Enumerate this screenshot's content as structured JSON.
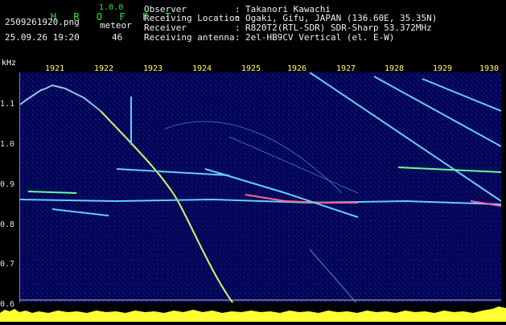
{
  "header": {
    "app_name": "H R O F F T",
    "version": "1.0.0",
    "filename": "2509261920.png",
    "datetime": "25.09.26 19:20",
    "counter_label": "meteor",
    "counter_value": "46",
    "info": [
      {
        "label": "Observer",
        "sep": ":",
        "value": "Takanori Kawachi"
      },
      {
        "label": "Receiving Location",
        "sep": ":",
        "value": "Ogaki, Gifu, JAPAN (136.60E, 35.35N)"
      },
      {
        "label": "Receiver",
        "sep": ":",
        "value": "R820T2(RTL-SDR) SDR-Sharp 53.372MHz"
      },
      {
        "label": "Receiving antenna",
        "sep": ":",
        "value": "2el-HB9CV Vertical (el. E-W)"
      }
    ]
  },
  "spectrogram": {
    "y_unit": "kHz",
    "y_ticks": [
      "1.1",
      "1.0",
      "0.9",
      "0.8",
      "0.7",
      "0.6"
    ],
    "x_ticks": [
      "1921",
      "1922",
      "1923",
      "1924",
      "1925",
      "1926",
      "1927",
      "1928",
      "1929",
      "1930"
    ],
    "colors": {
      "background": "#000044",
      "trace": "#66ccff",
      "hot": "#ffff66",
      "label": "#ffff66"
    }
  }
}
